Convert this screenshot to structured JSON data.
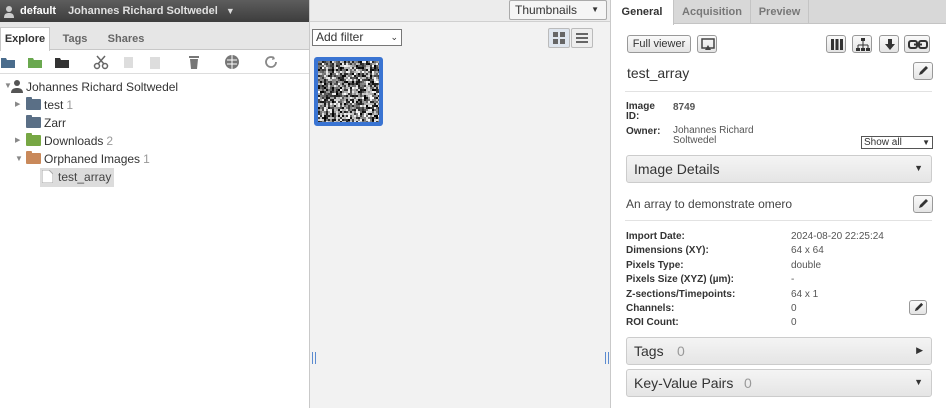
{
  "header": {
    "group_name": "default",
    "user_name": "Johannes Richard Soltwedel"
  },
  "left_tabs": [
    "Explore",
    "Tags",
    "Shares"
  ],
  "tree": {
    "root_user": "Johannes Richard Soltwedel",
    "items": [
      {
        "label": "test",
        "count": "1"
      },
      {
        "label": "Zarr",
        "count": ""
      },
      {
        "label": "Downloads",
        "count": "2"
      },
      {
        "label": "Orphaned Images",
        "count": "1"
      },
      {
        "label": "test_array",
        "count": ""
      }
    ]
  },
  "center": {
    "view_select": "Thumbnails",
    "filter_select": "Add filter"
  },
  "right_tabs": [
    "General",
    "Acquisition",
    "Preview"
  ],
  "right": {
    "full_viewer_label": "Full viewer",
    "image_name": "test_array",
    "image_id_label": "Image ID:",
    "image_id_value": "8749",
    "owner_label": "Owner:",
    "owner_value": "Johannes Richard Soltwedel",
    "owner_filter": "Show all",
    "image_details_title": "Image Details",
    "description": "An array to demonstrate omero",
    "details": [
      {
        "label": "Import Date:",
        "value": "2024-08-20 22:25:24"
      },
      {
        "label": "Dimensions (XY):",
        "value": "64 x 64"
      },
      {
        "label": "Pixels Type:",
        "value": "double"
      },
      {
        "label": "Pixels Size (XYZ) (µm):",
        "value": "-"
      },
      {
        "label": "Z-sections/Timepoints:",
        "value": "64 x 1"
      },
      {
        "label": "Channels:",
        "value": "0"
      },
      {
        "label": "ROI Count:",
        "value": "0"
      }
    ],
    "tags_title": "Tags",
    "tags_count": "0",
    "kvp_title": "Key-Value Pairs",
    "kvp_count": "0"
  }
}
